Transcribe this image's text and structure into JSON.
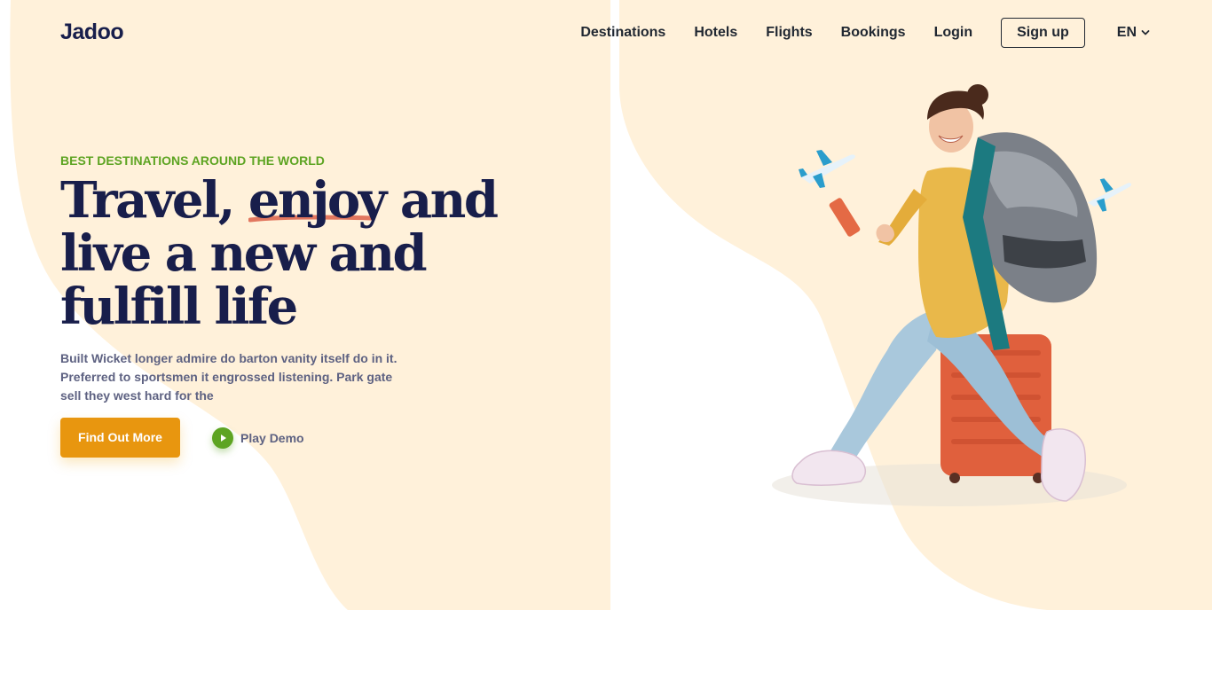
{
  "brand": {
    "logo": "Jadoo"
  },
  "nav": {
    "items": [
      "Destinations",
      "Hotels",
      "Flights",
      "Bookings",
      "Login"
    ],
    "signup": "Sign up",
    "language": "EN"
  },
  "hero": {
    "kicker": "BEST DESTINATIONS AROUND THE WORLD",
    "headline": {
      "line1_word1": "Travel,",
      "line1_word2": "enjoy",
      "line1_word3": "and",
      "line2": "live a new and",
      "line3": "fulfill life"
    },
    "description": "Built Wicket longer admire do barton vanity itself do in it. Preferred to sportsmen it engrossed listening. Park gate sell they west hard for the",
    "cta_label": "Find Out More",
    "demo_label": "Play Demo"
  },
  "colors": {
    "background_blob": "#fff1da",
    "headline": "#181e4b",
    "accent_green": "#5da422",
    "cta_orange": "#e8960f",
    "underline": "#df6951",
    "body_text": "#5e6282"
  },
  "icons": {
    "language_caret": "chevron-down-icon",
    "play": "play-icon",
    "plane": "airplane-icon"
  }
}
